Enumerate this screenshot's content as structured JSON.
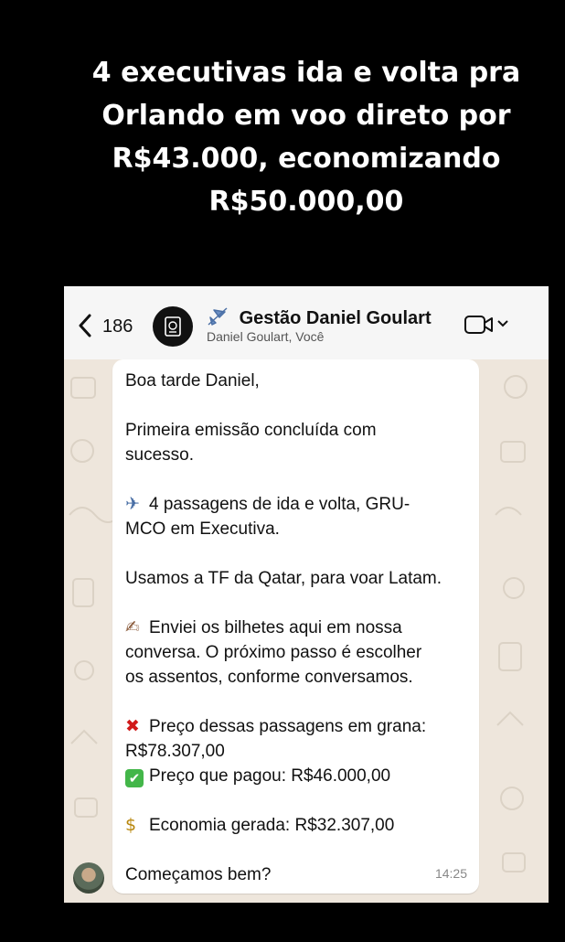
{
  "headline": {
    "line1": "4 executivas ida e volta pra",
    "line2": "Orlando em voo direto por",
    "line3": "R$43.000, economizando",
    "line4": "R$50.000,00"
  },
  "chat_header": {
    "back_count": "186",
    "title_emoji": "plane-icon",
    "title": "Gestão Daniel Goulart",
    "subtitle": "Daniel Goulart, Você"
  },
  "message": {
    "greeting": "Boa tarde Daniel,",
    "line_emission_1": "Primeira emissão concluída com",
    "line_emission_2": "sucesso.",
    "line_tickets_1": "4 passagens de ida e volta, GRU-",
    "line_tickets_2": "MCO em Executiva.",
    "line_tf": "Usamos a TF da Qatar, para voar Latam.",
    "line_sent_1": "Enviei os bilhetes aqui em nossa",
    "line_sent_2": "conversa. O próximo passo é escolher",
    "line_sent_3": "os assentos, conforme conversamos.",
    "line_price_1": "Preço dessas passagens em grana:",
    "line_price_2": "R$78.307,00",
    "line_paid": "Preço que pagou: R$46.000,00",
    "line_savings": "Economia gerada: R$32.307,00",
    "line_closing": "Começamos bem?",
    "time": "14:25"
  },
  "colors": {
    "background": "#000000",
    "chat_wallpaper": "#eee6dc",
    "bubble": "#ffffff",
    "check": "#43b649",
    "cross": "#d11a1a"
  }
}
